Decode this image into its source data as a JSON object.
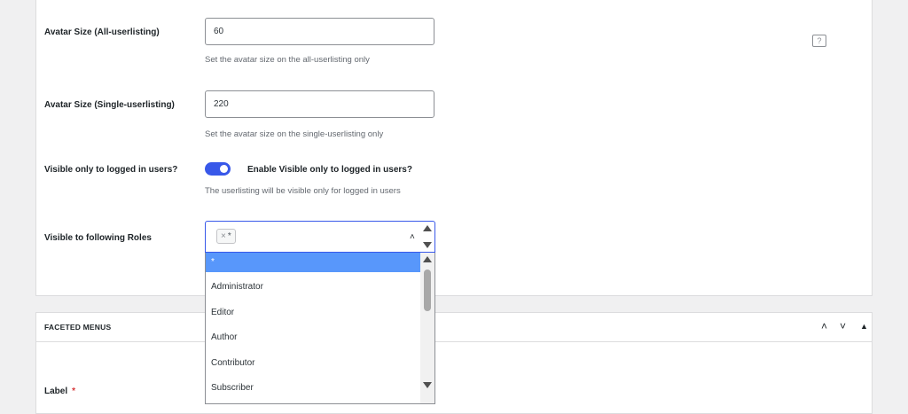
{
  "settings": {
    "avatar_all": {
      "label": "Avatar Size (All-userlisting)",
      "value": "60",
      "description": "Set the avatar size on the all-userlisting only"
    },
    "avatar_single": {
      "label": "Avatar Size (Single-userlisting)",
      "value": "220",
      "description": "Set the avatar size on the single-userlisting only"
    },
    "visible_logged_in": {
      "label": "Visible only to logged in users?",
      "toggle_label": "Enable Visible only to logged in users?",
      "description": "The userlisting will be visible only for logged in users",
      "enabled": true
    },
    "visible_roles": {
      "label": "Visible to following Roles",
      "selected_tag": "*",
      "tag_remove": "×",
      "options": [
        "*",
        "Administrator",
        "Editor",
        "Author",
        "Contributor",
        "Subscriber"
      ]
    }
  },
  "faceted_menus": {
    "title": "FACETED MENUS",
    "help": "?",
    "label_field": {
      "label": "Label",
      "required_mark": "*"
    }
  },
  "colors": {
    "accent": "#3858e9",
    "selected_option": "#5897fb",
    "required": "#d63638"
  }
}
